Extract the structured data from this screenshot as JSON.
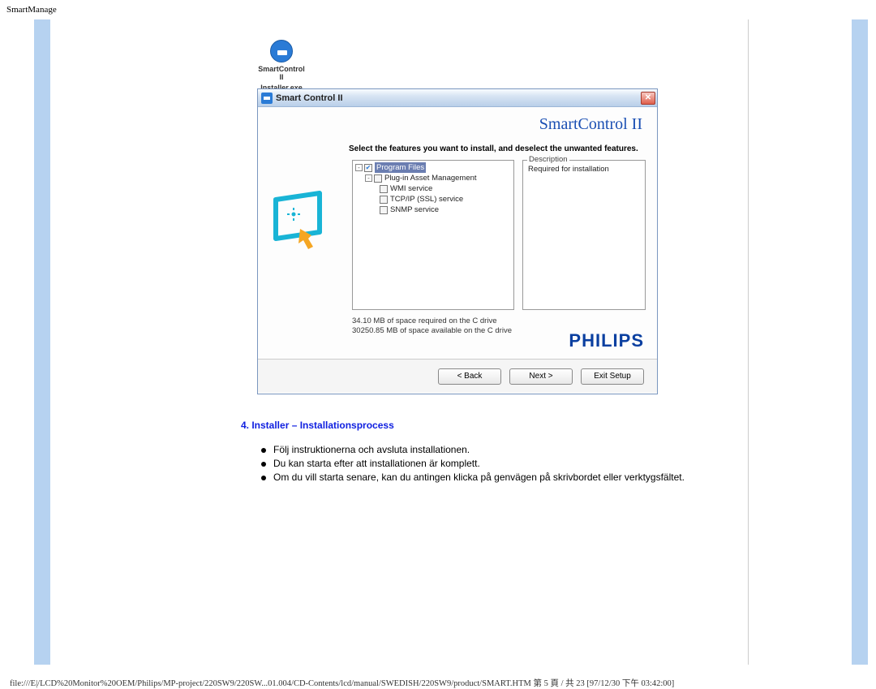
{
  "page_header_link": "SmartManage",
  "desktop_icon": {
    "line1": "SmartControl II",
    "line2": "Installer.exe"
  },
  "window": {
    "title": "Smart Control II",
    "brand_title": "SmartControl II",
    "instruction": "Select the features you want to install, and deselect the unwanted features.",
    "features": {
      "root": "Program Files",
      "node1": "Plug-in Asset Management",
      "leaf1": "WMI service",
      "leaf2": "TCP/IP (SSL) service",
      "leaf3": "SNMP service"
    },
    "description": {
      "legend": "Description",
      "text": "Required for installation"
    },
    "space_required": "34.10 MB of space required on the C drive",
    "space_available": "30250.85 MB of space available on the C drive",
    "brand_logo": "PHILIPS",
    "buttons": {
      "back": "<  Back",
      "next": "Next  >",
      "exit": "Exit Setup"
    }
  },
  "section_heading": "4. Installer – Installationsprocess",
  "bullets": [
    "Följ instruktionerna och avsluta installationen.",
    "Du kan starta efter att installationen är komplett.",
    "Om du vill starta senare, kan du antingen klicka på genvägen på skrivbordet eller verktygsfältet."
  ],
  "footer": "file:///E|/LCD%20Monitor%20OEM/Philips/MP-project/220SW9/220SW...01.004/CD-Contents/lcd/manual/SWEDISH/220SW9/product/SMART.HTM 第 5 頁 / 共 23  [97/12/30 下午 03:42:00]"
}
